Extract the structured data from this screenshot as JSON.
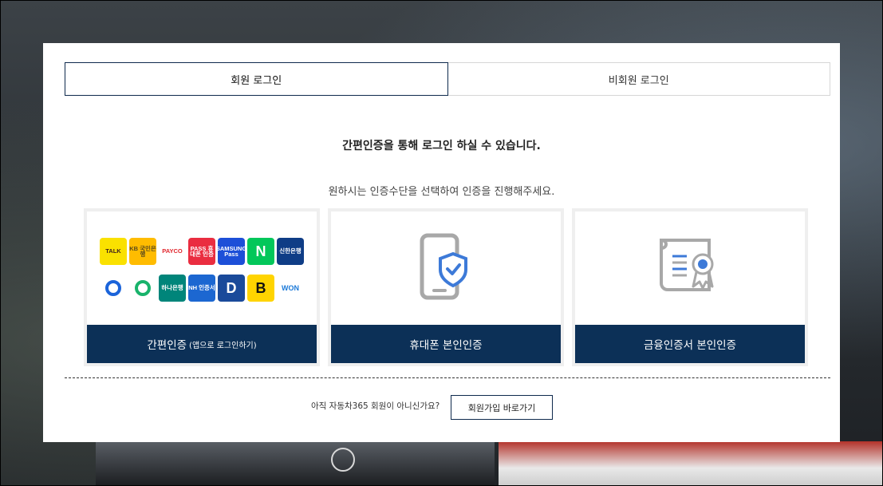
{
  "tabs": {
    "member_login": "회원 로그인",
    "guest_login": "비회원 로그인"
  },
  "headline": "간편인증을 통해 로그인 하실 수 있습니다.",
  "subline": "원하시는 인증수단을 선택하여 인증을 진행해주세요.",
  "cards": {
    "simple_auth": {
      "label": "간편인증",
      "sub_label": "(앱으로 로그인하기)",
      "logos": [
        {
          "icon": "kakaotalk-icon",
          "text": "TALK",
          "bg": "#fae100",
          "fg": "#3c1e1e"
        },
        {
          "icon": "kb-bank-icon",
          "text": "KB 국민은행",
          "bg": "#ffbc00",
          "fg": "#5a4a1d"
        },
        {
          "icon": "payco-icon",
          "text": "PAYCO",
          "bg": "#ffffff",
          "fg": "#e1262d"
        },
        {
          "icon": "pass-icon",
          "text": "PASS 휴대폰 인증",
          "bg": "#ea2d40",
          "fg": "#ffffff"
        },
        {
          "icon": "samsung-pass-icon",
          "text": "SAMSUNG Pass",
          "bg": "#1d4fd8",
          "fg": "#ffffff"
        },
        {
          "icon": "naver-icon",
          "text": "N",
          "bg": "#03c75a",
          "fg": "#ffffff"
        },
        {
          "icon": "shinhan-bank-icon",
          "text": "신한은행",
          "bg": "#0f3d86",
          "fg": "#ffffff"
        },
        {
          "icon": "toss-icon",
          "text": "",
          "bg": "#ffffff",
          "fg": "#1b64da"
        },
        {
          "icon": "banksalad-icon",
          "text": "",
          "bg": "#ffffff",
          "fg": "#19b36b"
        },
        {
          "icon": "hana-bank-icon",
          "text": "하나은행",
          "bg": "#00857a",
          "fg": "#ffffff"
        },
        {
          "icon": "nh-bank-icon",
          "text": "NH 인증서",
          "bg": "#1c67d1",
          "fg": "#ffffff"
        },
        {
          "icon": "dream-security-icon",
          "text": "D",
          "bg": "#1a4a9a",
          "fg": "#ffffff"
        },
        {
          "icon": "b-icon",
          "text": "B",
          "bg": "#ffd400",
          "fg": "#111111"
        },
        {
          "icon": "woori-won-icon",
          "text": "WON",
          "bg": "#ffffff",
          "fg": "#1c7ad8"
        }
      ]
    },
    "phone_auth": {
      "label": "휴대폰 본인인증",
      "icon": "phone-shield-icon"
    },
    "cert_auth": {
      "label": "금융인증서 본인인증",
      "icon": "certificate-icon"
    }
  },
  "footer": {
    "question": "아직 자동차365 회원이 아니신가요?",
    "join_button": "회원가입 바로가기"
  },
  "colors": {
    "primary_navy": "#0c3057",
    "card_border": "#efefef",
    "icon_gray": "#a8a8a8",
    "icon_blue": "#3d7ad8"
  }
}
